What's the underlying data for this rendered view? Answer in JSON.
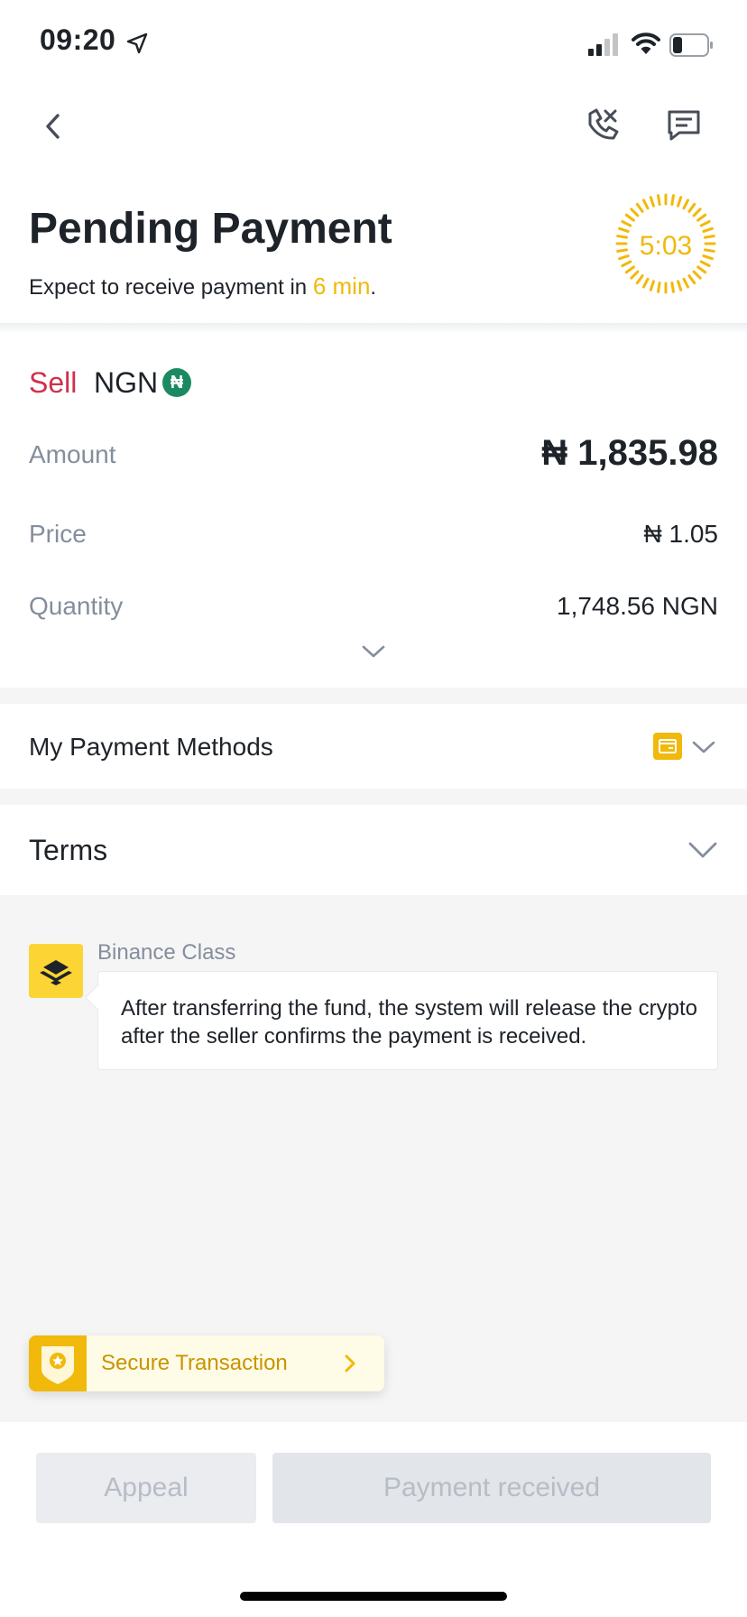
{
  "status_bar": {
    "time": "09:20"
  },
  "header": {
    "title": "Pending Payment",
    "subtitle_prefix": "Expect to receive payment in ",
    "subtitle_highlight": "6 min",
    "subtitle_suffix": ".",
    "timer": "5:03"
  },
  "order": {
    "side": "Sell",
    "currency": "NGN",
    "currency_symbol": "₦",
    "rows": [
      {
        "label": "Amount",
        "value": "₦ 1,835.98"
      },
      {
        "label": "Price",
        "value": "₦ 1.05"
      },
      {
        "label": "Quantity",
        "value": "1,748.56 NGN"
      }
    ]
  },
  "payment_methods": {
    "label": "My Payment Methods"
  },
  "terms": {
    "label": "Terms"
  },
  "binance_class": {
    "name": "Binance Class",
    "message": "After transferring the fund, the system will release the crypto after the seller confirms the payment is received."
  },
  "secure": {
    "label": "Secure Transaction"
  },
  "actions": {
    "appeal": "Appeal",
    "payment_received": "Payment received"
  },
  "colors": {
    "accent": "#f0b90b",
    "sell": "#cf304a",
    "ngn_badge": "#1c8a61"
  }
}
